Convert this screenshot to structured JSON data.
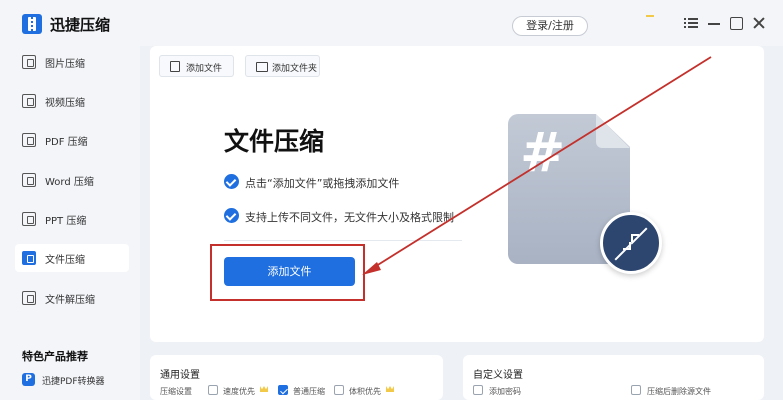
{
  "app": {
    "title": "迅捷压缩",
    "login_label": "登录/注册"
  },
  "sidebar": {
    "items": [
      {
        "label": "图片压缩",
        "icon": "image-icon",
        "active": false
      },
      {
        "label": "视频压缩",
        "icon": "video-icon",
        "active": false
      },
      {
        "label": "PDF 压缩",
        "icon": "pdf-icon",
        "active": false
      },
      {
        "label": "Word 压缩",
        "icon": "word-icon",
        "active": false
      },
      {
        "label": "PPT 压缩",
        "icon": "ppt-icon",
        "active": false
      },
      {
        "label": "文件压缩",
        "icon": "file-compress-icon",
        "active": true
      },
      {
        "label": "文件解压缩",
        "icon": "file-decompress-icon",
        "active": false
      }
    ],
    "section_title": "特色产品推荐",
    "featured": {
      "label": "迅捷PDF转换器",
      "icon_text": "P"
    }
  },
  "toolbar": {
    "add_file": "添加文件",
    "add_folder": "添加文件夹"
  },
  "main": {
    "title": "文件压缩",
    "features": [
      "点击“添加文件”或拖拽添加文件",
      "支持上传不同文件，无文件大小及格式限制"
    ],
    "add_button": "添加文件",
    "illustration_glyph": "#"
  },
  "general_settings": {
    "title": "通用设置",
    "row_label": "压缩设置",
    "options": [
      {
        "label": "速度优先",
        "checked": false,
        "vip": true
      },
      {
        "label": "普通压缩",
        "checked": true,
        "vip": false
      },
      {
        "label": "体积优先",
        "checked": false,
        "vip": true
      }
    ]
  },
  "custom_settings": {
    "title": "自定义设置",
    "options": [
      {
        "label": "添加密码",
        "checked": false
      },
      {
        "label": "压缩后删除源文件",
        "checked": false
      }
    ]
  },
  "colors": {
    "accent": "#1f6fe0",
    "annotation": "#c4302b",
    "vip": "#f3c94a"
  }
}
